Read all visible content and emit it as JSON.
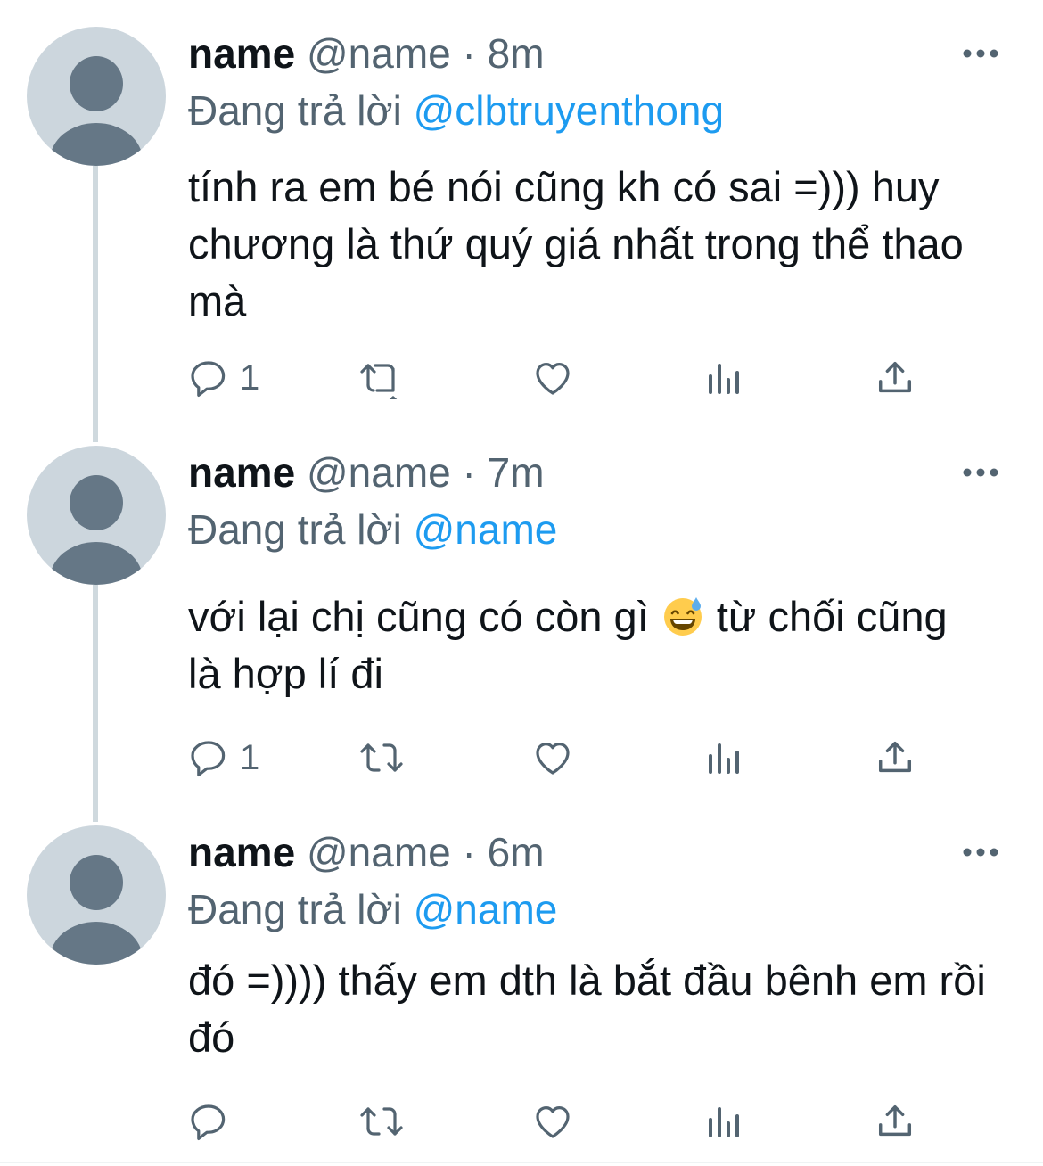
{
  "tweets": [
    {
      "name": "name",
      "handle": "@name",
      "dot": "·",
      "time": "8m",
      "reply_prefix": "Đang trả lời",
      "reply_mention": "@clbtruyenthong",
      "text": "tính ra em bé nói cũng kh có sai =))) huy chương là thứ quý giá nhất trong thể thao mà",
      "reply_count": "1"
    },
    {
      "name": "name",
      "handle": "@name",
      "dot": "·",
      "time": "7m",
      "reply_prefix": "Đang trả lời",
      "reply_mention": "@name",
      "text_before_emoji": "với lại chị cũng có còn gì",
      "emoji": "grinning-face-with-sweat",
      "text_after_emoji": " từ chối cũng là hợp lí đi",
      "reply_count": "1"
    },
    {
      "name": "name",
      "handle": "@name",
      "dot": "·",
      "time": "6m",
      "reply_prefix": "Đang trả lời",
      "reply_mention": "@name",
      "text": "đó =)))) thấy em dth là bắt đầu bênh em rồi đó",
      "reply_count": ""
    }
  ],
  "icons": {
    "reply": "reply-bubble-icon",
    "retweet": "retweet-icon",
    "like": "heart-icon",
    "views": "views-bar-icon",
    "share": "share-upload-icon",
    "more": "more-dots-icon",
    "avatar": "default-avatar-icon"
  },
  "colors": {
    "name": "#0f1419",
    "secondary": "#536471",
    "mention": "#1d9bf0",
    "thread_line": "#cfd9de",
    "avatar_bg": "#ccd6dd",
    "avatar_fg": "#657786"
  }
}
